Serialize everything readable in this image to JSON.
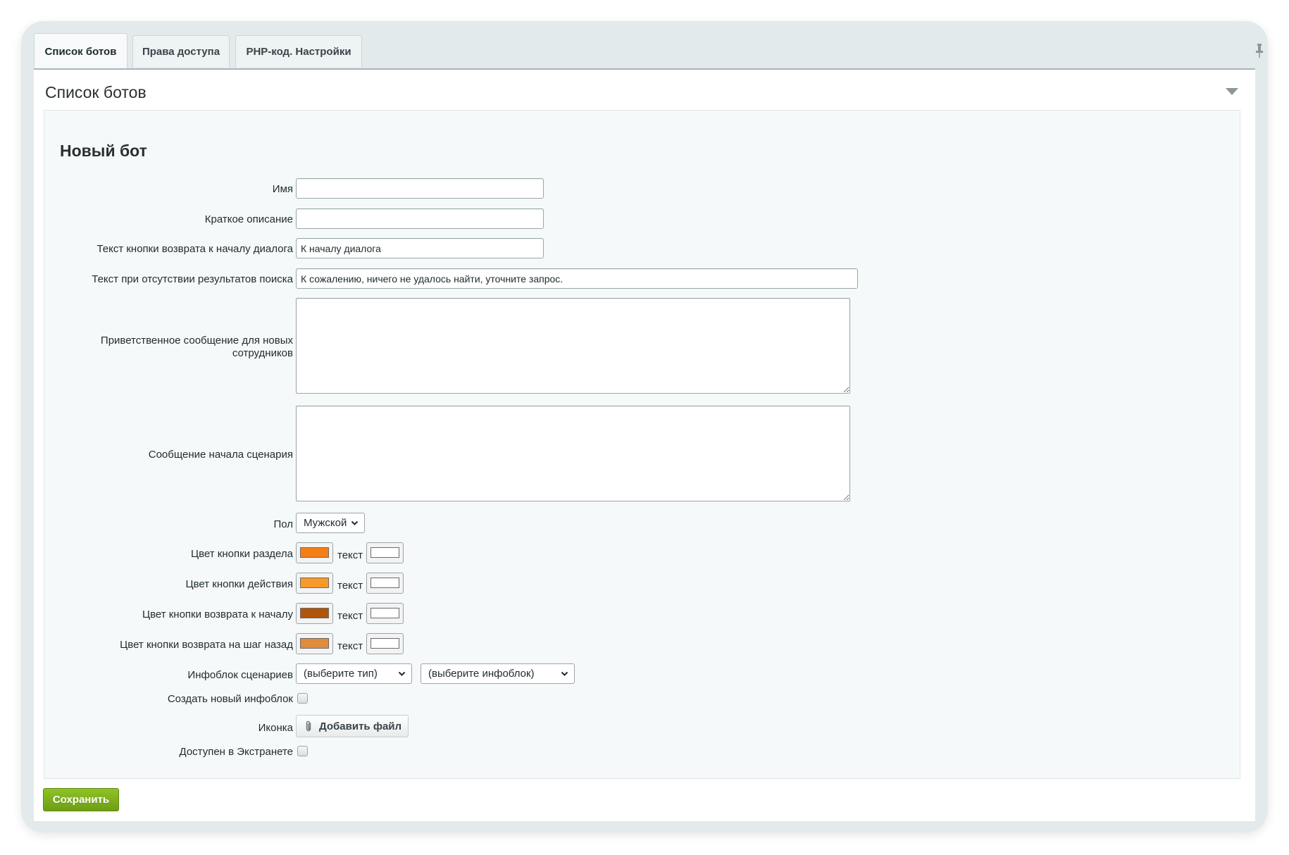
{
  "tabs": [
    {
      "label": "Список ботов",
      "active": true
    },
    {
      "label": "Права доступа",
      "active": false
    },
    {
      "label": "PHP-код. Настройки",
      "active": false
    }
  ],
  "panel": {
    "title": "Список ботов"
  },
  "form": {
    "section_title": "Новый бот",
    "name": {
      "label": "Имя",
      "value": ""
    },
    "short_description": {
      "label": "Краткое описание",
      "value": ""
    },
    "return_button_text": {
      "label": "Текст кнопки возврата к началу диалога",
      "value": "К началу диалога"
    },
    "no_results_text": {
      "label": "Текст при отсутствии результатов поиска",
      "value": "К сожалению, ничего не удалось найти, уточните запрос."
    },
    "welcome_message": {
      "label": "Приветственное сообщение для новых сотрудников",
      "value": ""
    },
    "scenario_start_message": {
      "label": "Сообщение начала сценария",
      "value": ""
    },
    "gender": {
      "label": "Пол",
      "value": "Мужской"
    },
    "text_label": "текст",
    "colors": [
      {
        "label": "Цвет кнопки раздела",
        "color": "#f57f17",
        "text_color": "#ffffff"
      },
      {
        "label": "Цвет кнопки действия",
        "color": "#f79a2a",
        "text_color": "#ffffff"
      },
      {
        "label": "Цвет кнопки возврата к началу",
        "color": "#b05509",
        "text_color": "#ffffff"
      },
      {
        "label": "Цвет кнопки возврата на шаг назад",
        "color": "#e08c3a",
        "text_color": "#ffffff"
      }
    ],
    "infoblock": {
      "label": "Инфоблок сценариев",
      "type_value": "(выберите тип)",
      "block_value": "(выберите инфоблок)"
    },
    "create_infoblock": {
      "label": "Создать новый инфоблок",
      "checked": false
    },
    "icon": {
      "label": "Иконка",
      "button_label": "Добавить файл"
    },
    "extranet": {
      "label": "Доступен в Экстранете",
      "checked": false
    }
  },
  "save_label": "Сохранить"
}
